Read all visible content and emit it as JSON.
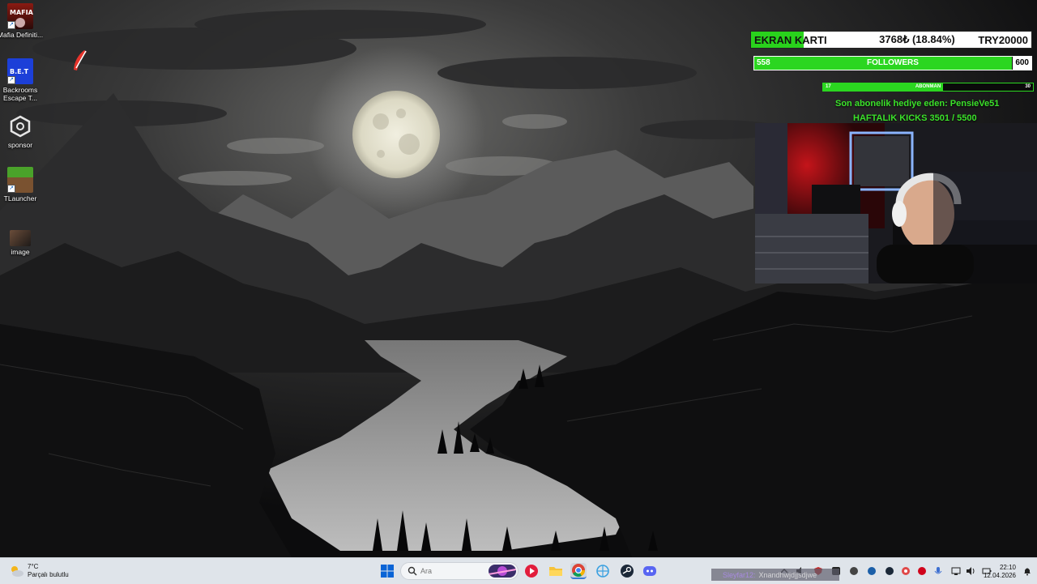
{
  "desktop": {
    "icons": [
      {
        "label": "Mafia Definiti...",
        "icon": "mafia-game-icon"
      },
      {
        "label": "Backrooms Escape T...",
        "icon": "backrooms-game-icon"
      },
      {
        "label": "sponsor",
        "icon": "sponsor-app-icon"
      },
      {
        "label": "TLauncher",
        "icon": "minecraft-grass-icon"
      },
      {
        "label": "image",
        "icon": "image-file-icon"
      }
    ],
    "extra_icon": "red-feather-logo-icon"
  },
  "overlay": {
    "goal": {
      "label": "EKRAN KARTI",
      "progress": "3768₺ (18.84%)",
      "target": "TRY20000",
      "fraction": 0.1884
    },
    "followers": {
      "current": "558",
      "label": "FOLLOWERS",
      "goal": "600",
      "fraction": 0.93
    },
    "subscribers": {
      "current": "17",
      "label": "ABONMAN",
      "goal": "30",
      "fraction": 0.57
    },
    "last_gift": "Son abonelik hediye eden: PensieVe51",
    "weekly_kicks": "HAFTALIK KICKS 3501 / 5500"
  },
  "taskbar": {
    "weather_temp": "7°C",
    "weather_desc": "Parçalı bulutlu",
    "search_placeholder": "Ara",
    "apps": [
      "windows-start-icon",
      "search-icon",
      "opera-gx-icon",
      "file-explorer-icon",
      "chrome-icon",
      "network-app-icon",
      "steam-icon",
      "discord-icon"
    ],
    "chat_user": "Sleyfar12:",
    "chat_message": "Xnandhwjdjjsdjwe",
    "tray": [
      "chevron-up-icon",
      "speaker-icon",
      "antivirus-icon",
      "app-icon",
      "app-icon",
      "app-icon",
      "app-icon",
      "steam-tray-icon",
      "app-icon",
      "record-icon",
      "app-icon",
      "microphone-icon",
      "network-icon",
      "volume-icon",
      "battery-icon"
    ],
    "time": "22:10",
    "date": "12.04.2026"
  },
  "colors": {
    "accent_green": "#2bd620",
    "text_green": "#3be22a"
  }
}
